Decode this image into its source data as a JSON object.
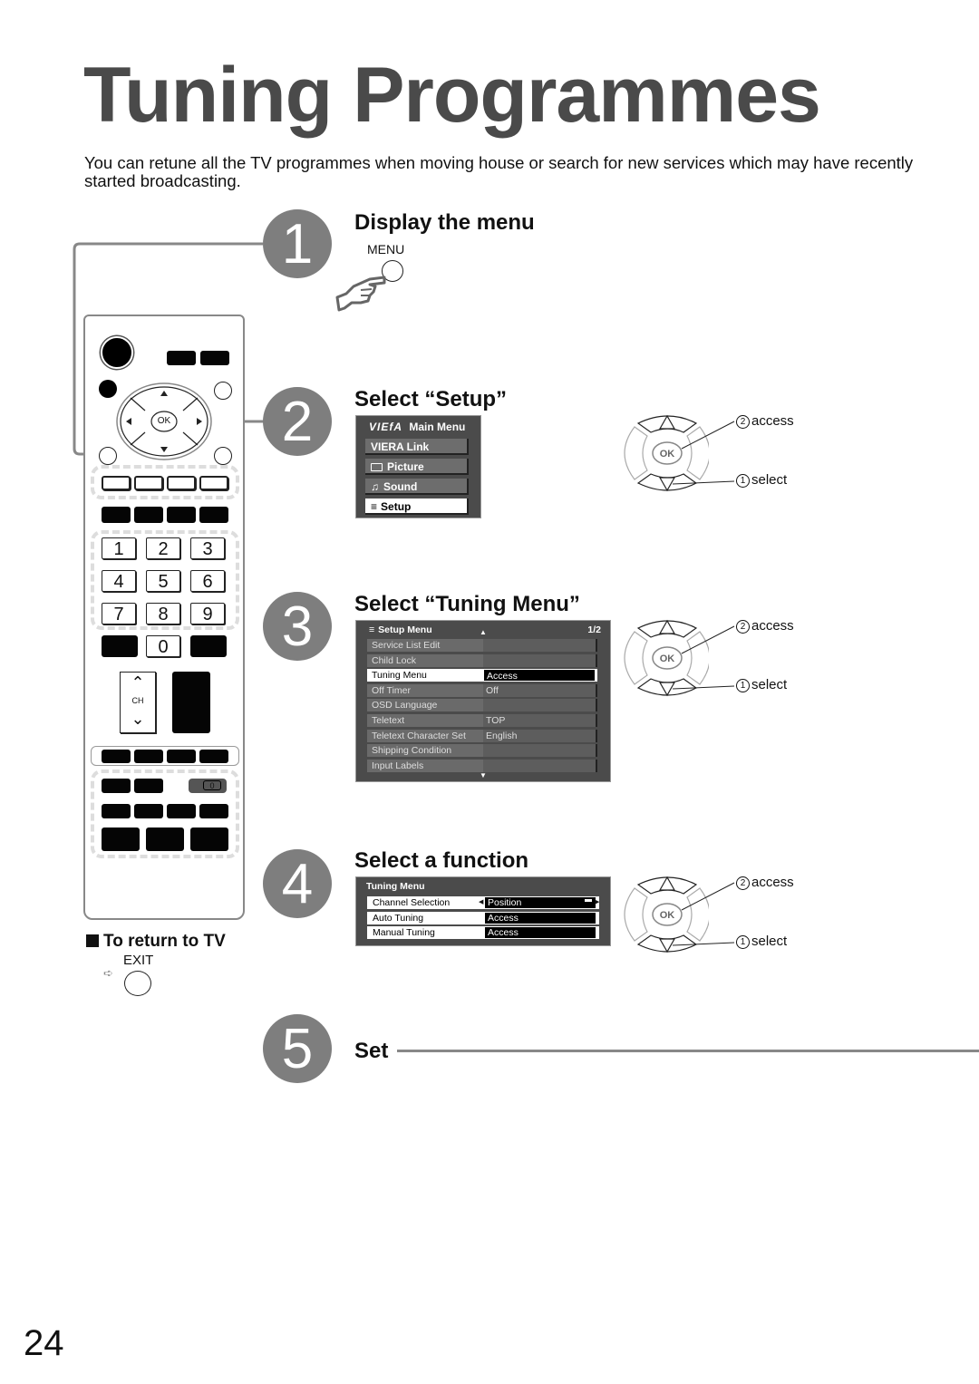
{
  "page": {
    "title": "Tuning Programmes",
    "intro": "You can retune all the TV programmes when moving house or search for new services which may have recently started broadcasting.",
    "page_number": "24"
  },
  "steps": [
    {
      "number": "1",
      "title": "Display the menu",
      "button_label": "MENU"
    },
    {
      "number": "2",
      "title": "Select “Setup”"
    },
    {
      "number": "3",
      "title": "Select “Tuning Menu”"
    },
    {
      "number": "4",
      "title": "Select a function"
    },
    {
      "number": "5",
      "title": "Set"
    }
  ],
  "main_menu": {
    "brand": "VIEfA",
    "title": "Main Menu",
    "items": [
      {
        "label": "VIERA Link",
        "icon": "",
        "selected": false
      },
      {
        "label": "Picture",
        "icon": "picture-icon",
        "selected": false
      },
      {
        "label": "Sound",
        "icon": "music-note-icon",
        "selected": false
      },
      {
        "label": "Setup",
        "icon": "list-icon",
        "selected": true
      }
    ]
  },
  "setup_menu": {
    "title": "Setup Menu",
    "page": "1/2",
    "rows": [
      {
        "label": "Service List Edit",
        "value": ""
      },
      {
        "label": "Child Lock",
        "value": ""
      },
      {
        "label": "Tuning Menu",
        "value": "Access",
        "selected": true
      },
      {
        "label": "Off Timer",
        "value": "Off"
      },
      {
        "label": "OSD Language",
        "value": ""
      },
      {
        "label": "Teletext",
        "value": "TOP"
      },
      {
        "label": "Teletext Character Set",
        "value": "English"
      },
      {
        "label": "Shipping Condition",
        "value": ""
      },
      {
        "label": "Input Labels",
        "value": ""
      }
    ]
  },
  "tuning_menu": {
    "title": "Tuning Menu",
    "rows": [
      {
        "label": "Channel Selection",
        "value": "Position"
      },
      {
        "label": "Auto Tuning",
        "value": "Access"
      },
      {
        "label": "Manual Tuning",
        "value": "Access"
      }
    ]
  },
  "navpad": {
    "ok_label": "OK",
    "access": {
      "num": "2",
      "label": "access"
    },
    "select": {
      "num": "1",
      "label": "select"
    }
  },
  "remote": {
    "ok_label": "OK",
    "ch_label": "CH",
    "digits": [
      "1",
      "2",
      "3",
      "4",
      "5",
      "6",
      "7",
      "8",
      "9",
      "0"
    ],
    "small_label": "0"
  },
  "return_tv": {
    "heading": "To return to TV",
    "button_label": "EXIT"
  }
}
